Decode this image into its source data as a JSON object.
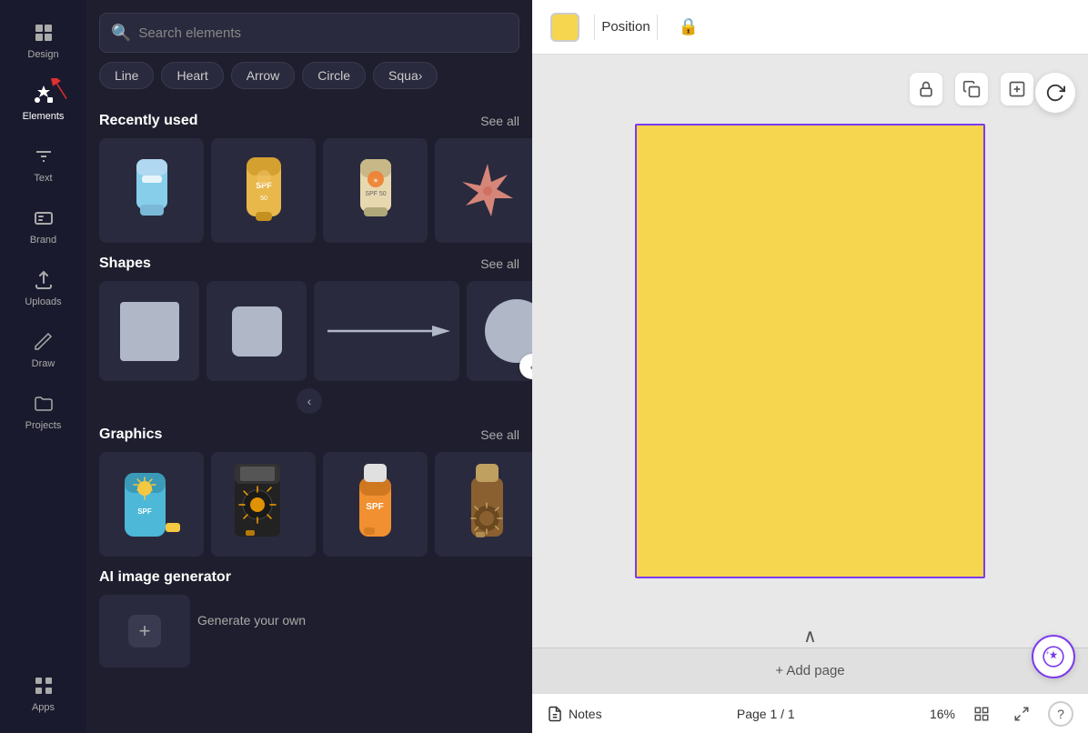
{
  "sidebar": {
    "items": [
      {
        "id": "design",
        "label": "Design",
        "icon": "grid"
      },
      {
        "id": "elements",
        "label": "Elements",
        "icon": "elements",
        "active": true
      },
      {
        "id": "text",
        "label": "Text",
        "icon": "text"
      },
      {
        "id": "brand",
        "label": "Brand",
        "icon": "brand"
      },
      {
        "id": "uploads",
        "label": "Uploads",
        "icon": "upload"
      },
      {
        "id": "draw",
        "label": "Draw",
        "icon": "draw"
      },
      {
        "id": "projects",
        "label": "Projects",
        "icon": "folder"
      },
      {
        "id": "apps",
        "label": "Apps",
        "icon": "apps"
      }
    ]
  },
  "panel": {
    "search_placeholder": "Search elements",
    "shape_pills": [
      "Line",
      "Heart",
      "Arrow",
      "Circle",
      "Squa…"
    ],
    "recently_used": {
      "title": "Recently used",
      "see_all": "See all"
    },
    "shapes": {
      "title": "Shapes",
      "see_all": "See all"
    },
    "graphics": {
      "title": "Graphics",
      "see_all": "See all"
    },
    "ai": {
      "title": "AI image generator",
      "subtitle": "Generate your own"
    }
  },
  "toolbar": {
    "position_label": "Position",
    "lock_icon": "🔒"
  },
  "canvas": {
    "background_color": "#f5d64e",
    "border_color": "#7c3aed"
  },
  "bottom_bar": {
    "notes_label": "Notes",
    "page_info": "Page 1 / 1",
    "zoom": "16%",
    "add_page": "+ Add page"
  }
}
